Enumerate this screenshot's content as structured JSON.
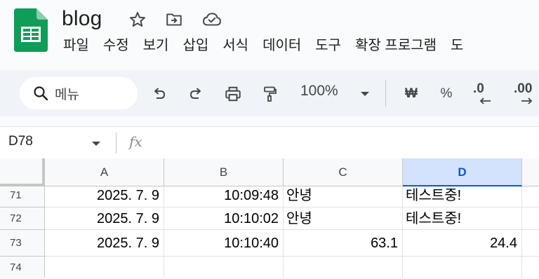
{
  "app": {
    "title": "blog",
    "menu": [
      "파일",
      "수정",
      "보기",
      "삽입",
      "서식",
      "데이터",
      "도구",
      "확장 프로그램",
      "도"
    ],
    "icons": [
      "star-icon",
      "move-to-folder-icon",
      "cloud-saved-icon"
    ],
    "brand_color": "#0f9d58"
  },
  "toolbar": {
    "menu_search_label": "메뉴",
    "zoom": "100%",
    "currency": "₩",
    "percent": "%",
    "decrease_decimal": ".0",
    "increase_decimal": ".00"
  },
  "formula_bar": {
    "name_box": "D78",
    "fx_label": "fx"
  },
  "grid": {
    "columns": [
      "A",
      "B",
      "C",
      "D"
    ],
    "selected_column": "D",
    "rows": [
      {
        "num": "71",
        "A": "2025. 7. 9",
        "B": "10:09:48",
        "C": "안녕",
        "D": "테스트중!"
      },
      {
        "num": "72",
        "A": "2025. 7. 9",
        "B": "10:10:02",
        "C": "안녕",
        "D": "테스트중!"
      },
      {
        "num": "73",
        "A": "2025. 7. 9",
        "B": "10:10:40",
        "C": "63.1",
        "D": "24.4"
      },
      {
        "num": "74",
        "A": "",
        "B": "",
        "C": "",
        "D": ""
      }
    ]
  }
}
